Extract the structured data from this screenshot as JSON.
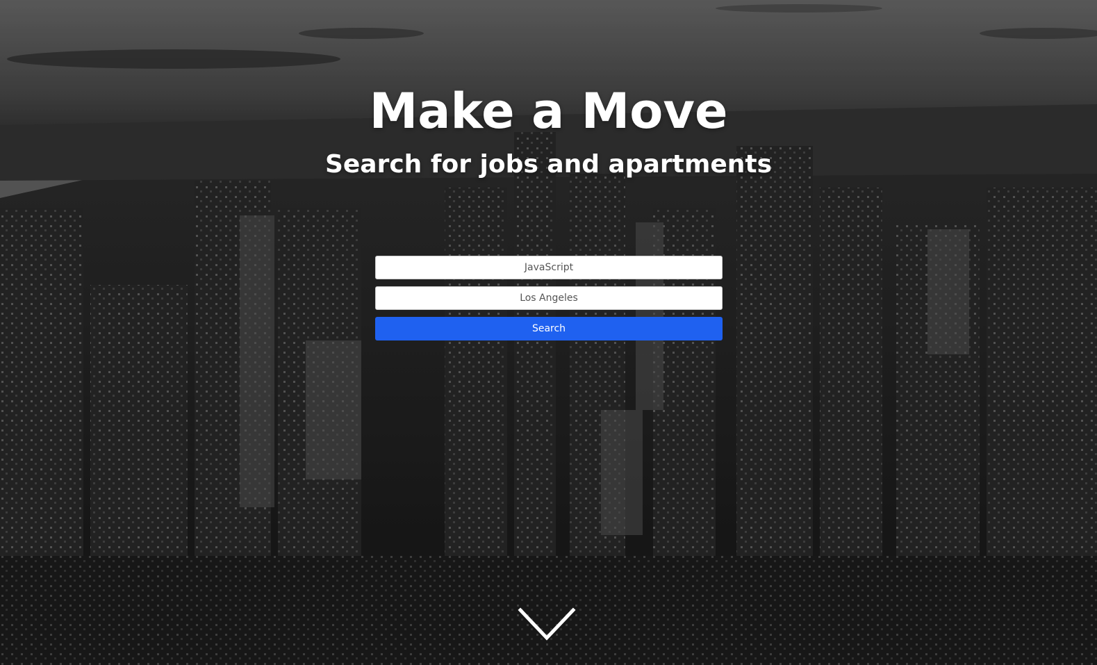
{
  "hero": {
    "title": "Make a Move",
    "subtitle": "Search for jobs and apartments"
  },
  "search_form": {
    "keyword_value": "JavaScript",
    "location_value": "Los Angeles",
    "submit_label": "Search"
  },
  "scroll_indicator": {
    "icon": "chevron-down-icon"
  },
  "colors": {
    "accent": "#1f61f0",
    "text_on_image": "#ffffff",
    "background_tone": "grayscale city skyline"
  }
}
